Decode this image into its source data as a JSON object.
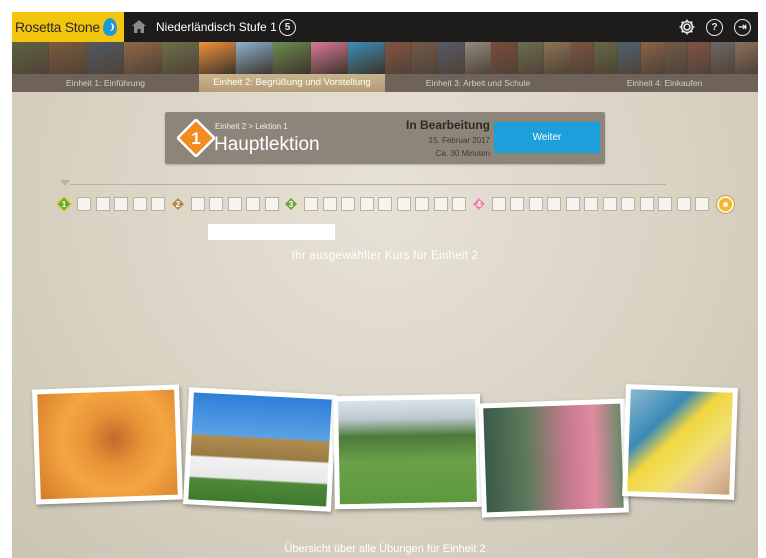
{
  "topbar": {
    "logo_text": "Rosetta Stone",
    "course_title": "Niederländisch Stufe 1",
    "course_level": "5",
    "help_symbol": "?",
    "exit_symbol": "⇥"
  },
  "units": [
    {
      "label": "Einheit 1: Einführung",
      "active": false
    },
    {
      "label": "Einheit 2: Begrüßung und Vorstellung",
      "active": true
    },
    {
      "label": "Einheit 3: Arbeit und Schule",
      "active": false
    },
    {
      "label": "Einheit 4: Einkaufen",
      "active": false
    }
  ],
  "thumbnail_colors": [
    [
      "#5e7d3e",
      "#a36a3c",
      "#3d6891",
      "#c98748",
      "#7c9a55"
    ],
    [
      "#f0923a",
      "#8cb3cf",
      "#6c8d4f",
      "#d97a96",
      "#3a8fb8"
    ],
    [
      "#b85a3c",
      "#8c6a52",
      "#4a6a96",
      "#d4d4cc",
      "#9c4a30",
      "#78965a",
      "#c4a070"
    ],
    [
      "#a05a3a",
      "#6a8a4a",
      "#3a7aa6",
      "#c47a4a",
      "#8a6a4a",
      "#b05a4a",
      "#7a8a9a",
      "#c49a7a"
    ]
  ],
  "lesson": {
    "badge_number": "1",
    "breadcrumb": "Einheit 2 > Lektion 1",
    "title": "Hauptlektion",
    "status": "In Bearbeitung",
    "date": "15. Februar 2017",
    "duration": "Ca. 30 Minuten",
    "continue_label": "Weiter"
  },
  "progress": {
    "milestones": [
      {
        "number": "1",
        "color": "#5cae3b",
        "border": "#f4b82a",
        "current": true
      },
      {
        "number": "2",
        "color": "#b08a52",
        "border": "#ead8b6",
        "current": false
      },
      {
        "number": "3",
        "color": "#6ea33a",
        "border": "#d8e6c4",
        "current": false
      },
      {
        "number": "4",
        "color": "#e68aa8",
        "border": "#f6d4df",
        "current": false
      }
    ],
    "squares_per_segment": [
      5,
      5,
      9,
      12
    ]
  },
  "course_caption": "Ihr ausgewählter Kurs für Einheit 2",
  "footer_caption": "Übersicht über alle Übungen für Einheit 2",
  "colors": {
    "logo_yellow": "#f1c60c",
    "accent_blue": "#1d9fdc",
    "topbar": "#1d1c1a"
  }
}
